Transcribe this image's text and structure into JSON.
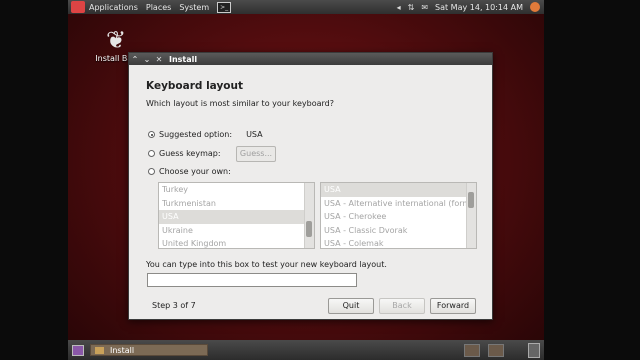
{
  "top_panel": {
    "menus": [
      "Applications",
      "Places",
      "System"
    ],
    "terminal_glyph": ">_",
    "clock": "Sat May 14, 10:14 AM"
  },
  "desktop": {
    "icon_label": "Install Bac"
  },
  "window": {
    "title": "Install",
    "heading": "Keyboard layout",
    "question": "Which layout is most similar to your keyboard?",
    "suggested_label": "Suggested option:",
    "suggested_value": "USA",
    "guess_label": "Guess keymap:",
    "guess_button": "Guess...",
    "choose_label": "Choose your own:",
    "selected_option": "suggested",
    "countries": [
      "Turkey",
      "Turkmenistan",
      "USA",
      "Ukraine",
      "United Kingdom"
    ],
    "selected_country": "USA",
    "variants": [
      "USA",
      "USA - Alternative international (form",
      "USA - Cherokee",
      "USA - Classic Dvorak",
      "USA - Colemak"
    ],
    "selected_variant": "USA",
    "test_label": "You can type into this box to test your new keyboard layout.",
    "test_value": "",
    "step": "Step 3 of 7",
    "quit": "Quit",
    "back": "Back",
    "forward": "Forward"
  },
  "bottom_panel": {
    "task_label": "Install"
  },
  "colors": {
    "desktop_bg": "#5e0f11",
    "panel": "#3a3a3a",
    "window_bg": "#edeceb"
  }
}
